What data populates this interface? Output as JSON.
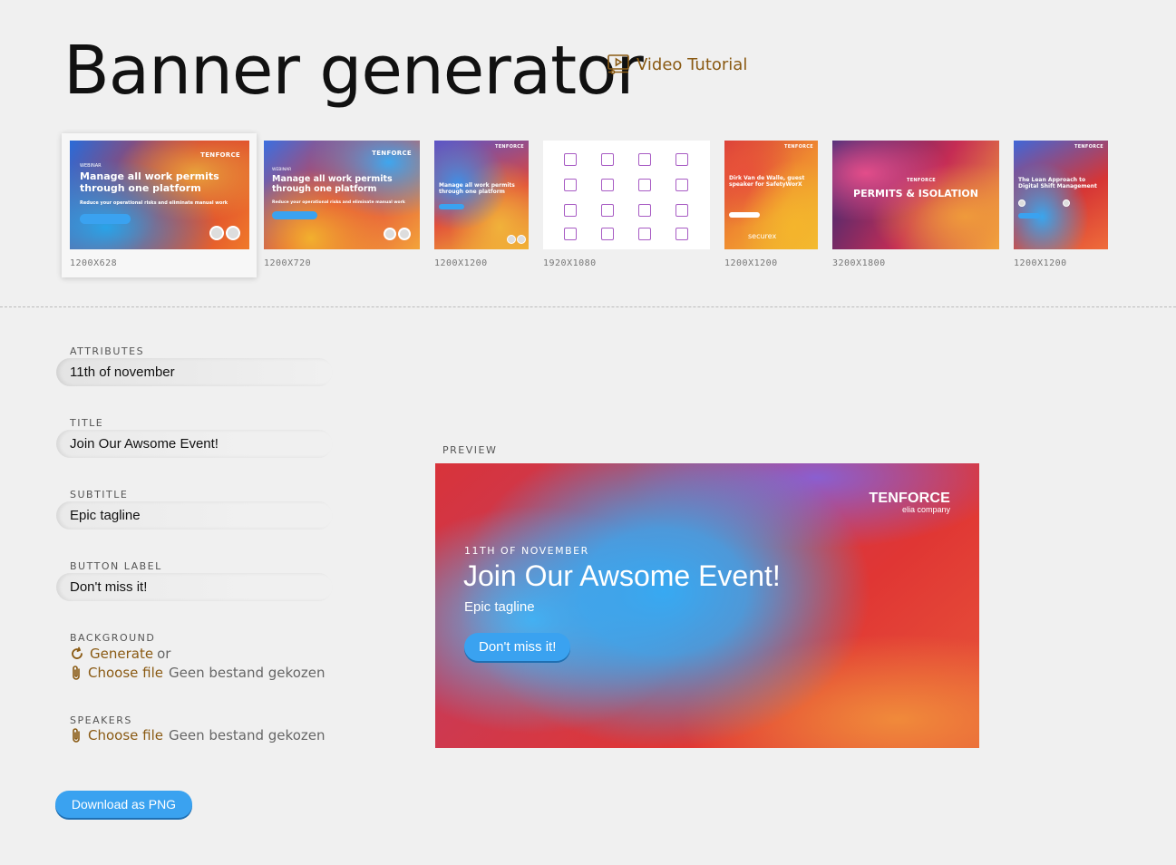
{
  "header": {
    "title": "Banner generator",
    "video_link_label": "Video Tutorial"
  },
  "templates": [
    {
      "size": "1200X628",
      "selected": true,
      "logo": "TENFORCE",
      "kicker": "WEBINAR",
      "headline": "Manage all work permits through one platform",
      "sub": "Reduce your operational risks and eliminate manual work",
      "button": "Watch the demo"
    },
    {
      "size": "1200X720",
      "selected": false,
      "logo": "TENFORCE",
      "kicker": "WEBINAR",
      "headline": "Manage all work permits through one platform",
      "sub": "Reduce your operational risks and eliminate manual work",
      "button": "Watch the demo"
    },
    {
      "size": "1200X1200",
      "selected": false,
      "logo": "TENFORCE",
      "headline": "Manage all work permits through one platform"
    },
    {
      "size": "1920X1080",
      "selected": false
    },
    {
      "size": "1200X1200",
      "selected": false,
      "logo": "TENFORCE",
      "headline": "Dirk Van de Walle, guest speaker for SafetyWorX",
      "footer_logo": "securex"
    },
    {
      "size": "3200X1800",
      "selected": false,
      "logo": "TENFORCE",
      "headline": "PERMITS & ISOLATION"
    },
    {
      "size": "1200X1200",
      "selected": false,
      "logo": "TENFORCE",
      "headline": "The Lean Approach to Digital Shift Management"
    }
  ],
  "form": {
    "attributes": {
      "label": "ATTRIBUTES",
      "value": "11th of november"
    },
    "title": {
      "label": "TITLE",
      "value": "Join Our Awsome Event!"
    },
    "subtitle": {
      "label": "SUBTITLE",
      "value": "Epic tagline"
    },
    "button_label": {
      "label": "BUTTON LABEL",
      "value": "Don't miss it!"
    },
    "background": {
      "label": "BACKGROUND",
      "generate": "Generate",
      "or": "or",
      "choose": "Choose file",
      "no_file": "Geen bestand gekozen"
    },
    "speakers": {
      "label": "SPEAKERS",
      "choose": "Choose file",
      "no_file": "Geen bestand gekozen"
    },
    "download": "Download as PNG"
  },
  "preview": {
    "label": "PREVIEW",
    "logo_brand": "TENFORCE",
    "logo_sub": "elia company",
    "attribute": "11TH OF NOVEMBER",
    "title": "Join Our Awsome Event!",
    "subtitle": "Epic tagline",
    "button": "Don't miss it!"
  },
  "colors": {
    "accent_link": "#8a5a13",
    "button_blue": "#3aa2f0",
    "background": "#f0f0f0"
  }
}
